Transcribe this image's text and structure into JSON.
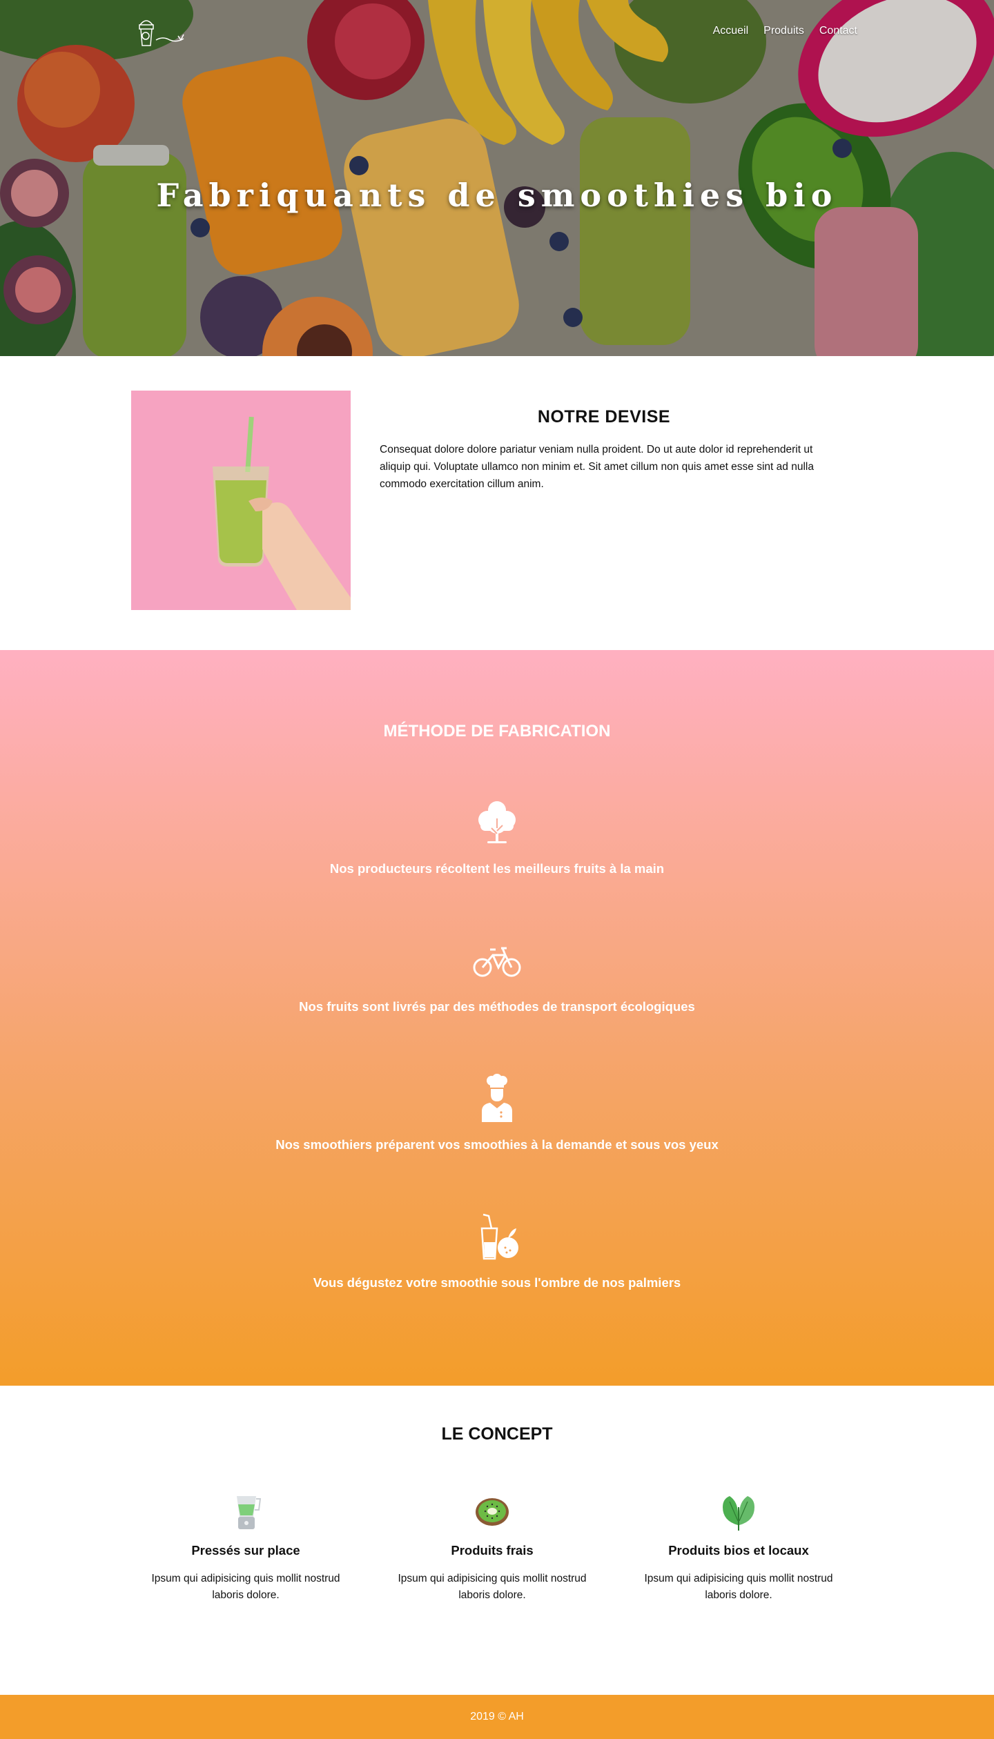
{
  "nav": {
    "links": [
      "Accueil",
      "Produits",
      "Contact"
    ]
  },
  "hero": {
    "title": "Fabriquants de smoothies bio"
  },
  "devise": {
    "heading": "NOTRE DEVISE",
    "text": "Consequat dolore dolore pariatur veniam nulla proident. Do ut aute dolor id reprehenderit ut aliquip qui. Voluptate ullamco non minim et. Sit amet cillum non quis amet esse sint ad nulla commodo exercitation cillum anim."
  },
  "methode": {
    "heading": "MÉTHODE DE FABRICATION",
    "steps": [
      {
        "icon": "tree-icon",
        "text": "Nos producteurs récoltent les meilleurs fruits à la main"
      },
      {
        "icon": "bicycle-icon",
        "text": "Nos fruits sont livrés par des méthodes de transport écologiques"
      },
      {
        "icon": "chef-icon",
        "text": "Nos smoothiers préparent vos smoothies à la demande et sous vos yeux"
      },
      {
        "icon": "drink-fruit-icon",
        "text": "Vous dégustez votre smoothie sous l'ombre de nos palmiers"
      }
    ]
  },
  "concept": {
    "heading": "LE CONCEPT",
    "cards": [
      {
        "icon": "blender-icon",
        "title": "Pressés sur place",
        "text": "Ipsum qui adipisicing quis mollit nostrud laboris dolore."
      },
      {
        "icon": "kiwi-icon",
        "title": "Produits frais",
        "text": "Ipsum qui adipisicing quis mollit nostrud laboris dolore."
      },
      {
        "icon": "leaf-icon",
        "title": "Produits bios et locaux",
        "text": "Ipsum qui adipisicing quis mollit nostrud laboris dolore."
      }
    ]
  },
  "footer": {
    "text": "2019 © AH"
  },
  "colors": {
    "accent": "#f39d2a",
    "pink": "#ffb0c1",
    "devise_bg": "#f6a3c1"
  }
}
